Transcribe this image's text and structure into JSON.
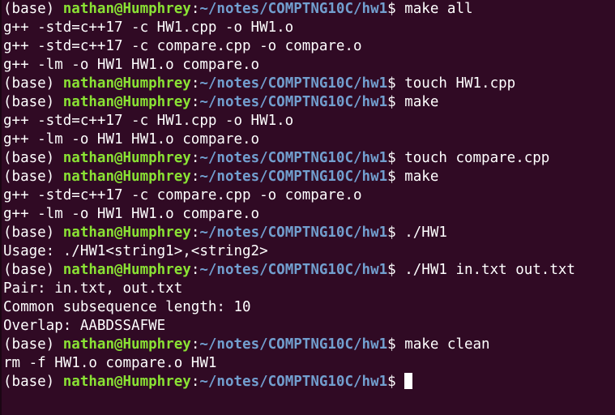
{
  "terminal": {
    "prompt": {
      "env": "(base) ",
      "user_host": "nathan@Humphrey",
      "colon": ":",
      "path": "~/notes/COMPTNG10C/hw1",
      "symbol": "$ "
    },
    "lines": [
      {
        "prompt": true,
        "text": "make all"
      },
      {
        "prompt": false,
        "text": "g++ -std=c++17 -c HW1.cpp -o HW1.o"
      },
      {
        "prompt": false,
        "text": "g++ -std=c++17 -c compare.cpp -o compare.o"
      },
      {
        "prompt": false,
        "text": "g++ -lm -o HW1 HW1.o compare.o"
      },
      {
        "prompt": true,
        "text": "touch HW1.cpp"
      },
      {
        "prompt": true,
        "text": "make"
      },
      {
        "prompt": false,
        "text": "g++ -std=c++17 -c HW1.cpp -o HW1.o"
      },
      {
        "prompt": false,
        "text": "g++ -lm -o HW1 HW1.o compare.o"
      },
      {
        "prompt": true,
        "text": "touch compare.cpp"
      },
      {
        "prompt": true,
        "text": "make"
      },
      {
        "prompt": false,
        "text": "g++ -std=c++17 -c compare.cpp -o compare.o"
      },
      {
        "prompt": false,
        "text": "g++ -lm -o HW1 HW1.o compare.o"
      },
      {
        "prompt": true,
        "text": "./HW1"
      },
      {
        "prompt": false,
        "text": "Usage: ./HW1<string1>,<string2>"
      },
      {
        "prompt": true,
        "text": "./HW1 in.txt out.txt"
      },
      {
        "prompt": false,
        "text": "Pair: in.txt, out.txt"
      },
      {
        "prompt": false,
        "text": "Common subsequence length: 10"
      },
      {
        "prompt": false,
        "text": "Overlap: AABDSSAFWE"
      },
      {
        "prompt": true,
        "text": "make clean"
      },
      {
        "prompt": false,
        "text": "rm -f HW1.o compare.o HW1"
      },
      {
        "prompt": true,
        "text": "",
        "cursor": true
      }
    ]
  },
  "colors": {
    "background": "#300a24",
    "user_host": "#8ae234",
    "path": "#729fcf",
    "text": "#ffffff"
  }
}
